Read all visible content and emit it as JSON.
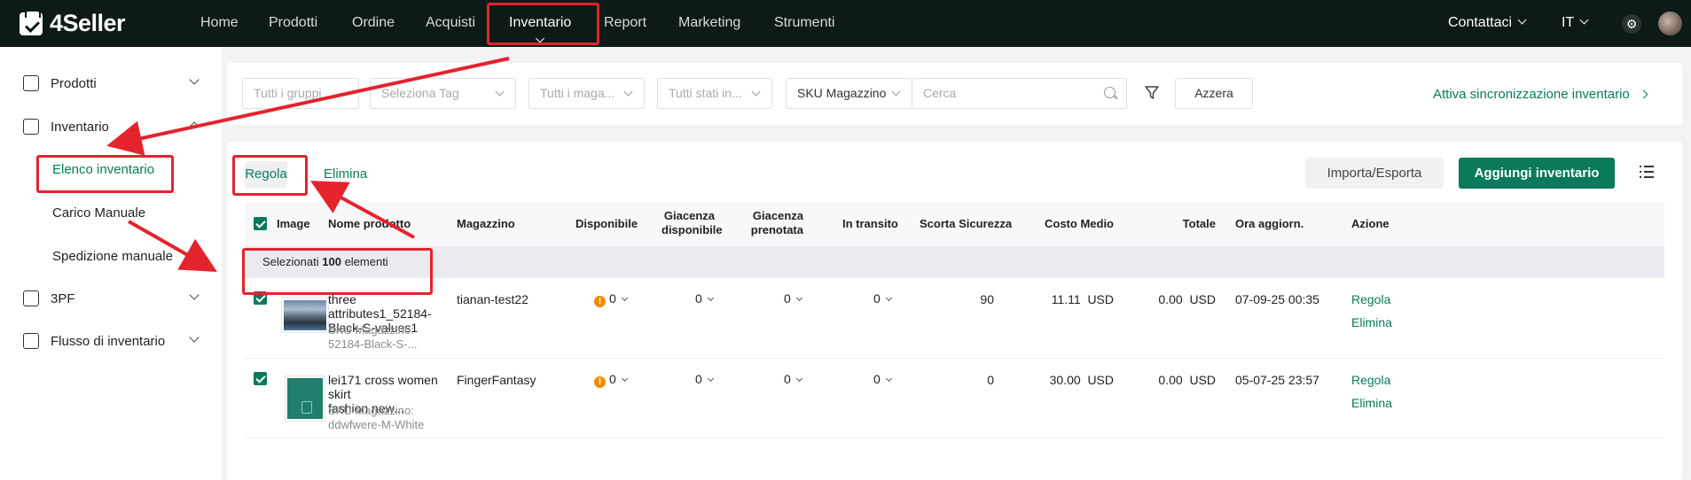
{
  "app": {
    "brand": "4Seller",
    "accent": "#0a7a5a",
    "annotation_color": "#e4232d"
  },
  "topnav": {
    "items": [
      {
        "label": "Home"
      },
      {
        "label": "Prodotti"
      },
      {
        "label": "Ordine"
      },
      {
        "label": "Acquisti"
      },
      {
        "label": "Inventario",
        "active": true
      },
      {
        "label": "Report"
      },
      {
        "label": "Marketing"
      },
      {
        "label": "Strumenti"
      }
    ],
    "contacts": "Contattaci",
    "language": "IT",
    "settings_icon": "gear-icon",
    "avatar": "user-avatar"
  },
  "sidebar": {
    "sections": [
      {
        "label": "Prodotti",
        "icon": "products-icon"
      },
      {
        "label": "Inventario",
        "icon": "inventory-icon",
        "expanded": true,
        "children": [
          {
            "label": "Elenco inventario",
            "active": true
          },
          {
            "label": "Carico Manuale"
          },
          {
            "label": "Spedizione manuale"
          }
        ]
      },
      {
        "label": "3PF",
        "icon": "warehouse-icon"
      },
      {
        "label": "Flusso di inventario",
        "icon": "flow-icon"
      }
    ]
  },
  "filters": {
    "groups_placeholder": "Tutti i gruppi",
    "tag_placeholder": "Seleziona Tag",
    "warehouse_placeholder": "Tutti i maga...",
    "status_placeholder": "Tutti stati in...",
    "sku_select": "SKU Magazzino",
    "search_placeholder": "Cerca",
    "reset_label": "Azzera",
    "sync_link": "Attiva sincronizzazione inventario"
  },
  "toolbar": {
    "adjust_tab": "Regola",
    "delete_tab": "Elimina",
    "import_export": "Importa/Esporta",
    "add_inventory": "Aggiungi inventario"
  },
  "table": {
    "columns": {
      "image": "Image",
      "name": "Nome prodotto",
      "warehouse": "Magazzino",
      "available": "Disponibile",
      "stock_available_1": "Giacenza",
      "stock_available_2": "disponibile",
      "stock_reserved_1": "Giacenza",
      "stock_reserved_2": "prenotata",
      "in_transit": "In transito",
      "safety_stock": "Scorta Sicurezza",
      "avg_cost": "Costo Medio",
      "total": "Totale",
      "updated": "Ora aggiorn.",
      "action": "Azione"
    },
    "selection": {
      "prefix": "Selezionati",
      "count": "100",
      "suffix": "elementi"
    },
    "rows": [
      {
        "name_1": "three attributes1_52184-",
        "name_2": "Black-S-values1",
        "sku_label": "SKU Magazzino:",
        "sku_value": "52184-Black-S-...",
        "warehouse": "tianan-test22",
        "available": "0",
        "stock_available": "0",
        "stock_reserved": "0",
        "in_transit": "0",
        "safety_stock": "90",
        "avg_cost": "11.11",
        "currency": "USD",
        "total": "0.00",
        "updated": "07-09-25 00:35",
        "action_adjust": "Regola",
        "action_delete": "Elimina"
      },
      {
        "name_1": "lei171 cross women skirt",
        "name_2": "fashion new...",
        "sku_label": "SKU Magazzino:",
        "sku_value": "ddwfwere-M-White",
        "warehouse": "FingerFantasy",
        "available": "0",
        "stock_available": "0",
        "stock_reserved": "0",
        "in_transit": "0",
        "safety_stock": "0",
        "avg_cost": "30.00",
        "currency": "USD",
        "total": "0.00",
        "updated": "05-07-25 23:57",
        "action_adjust": "Regola",
        "action_delete": "Elimina"
      }
    ]
  }
}
